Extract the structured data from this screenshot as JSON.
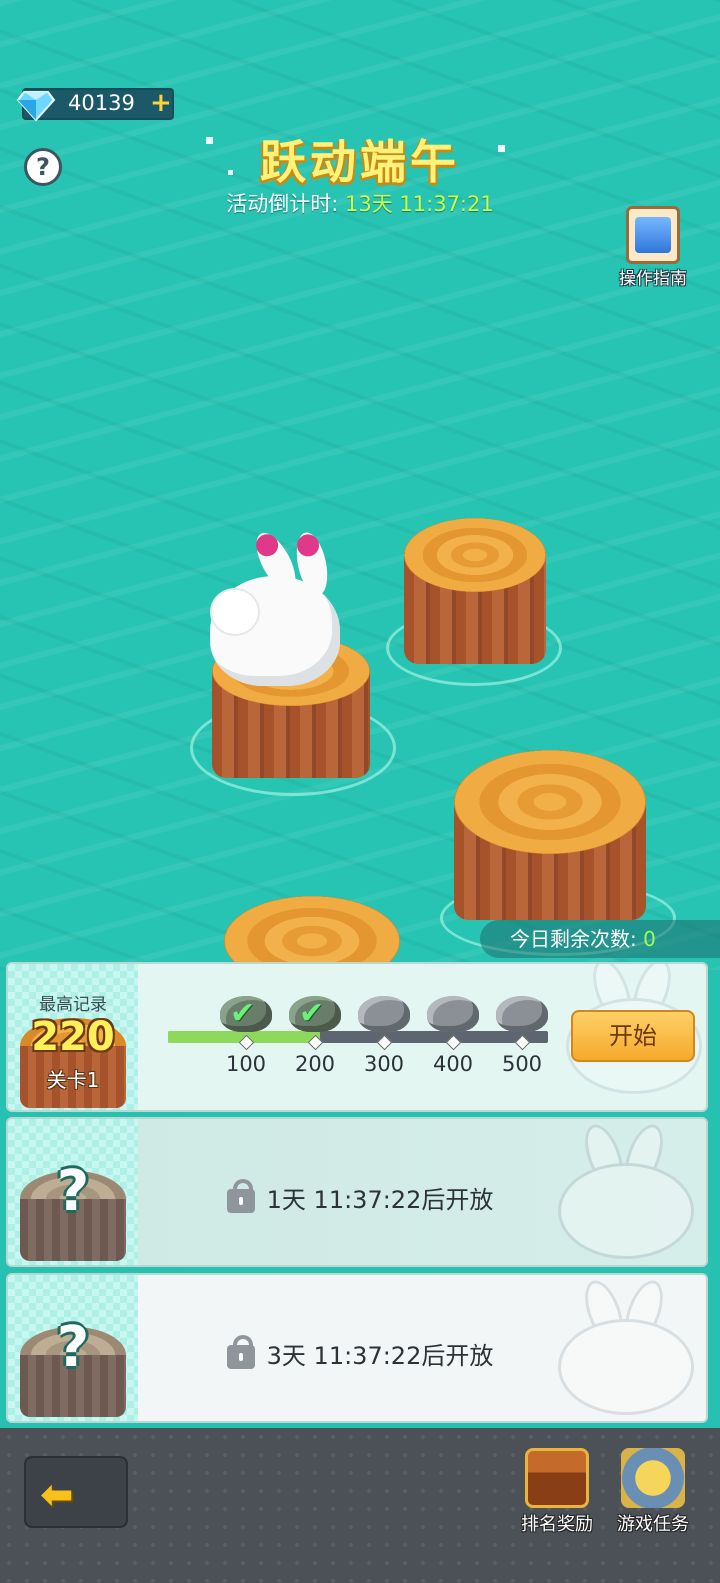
{
  "top": {
    "gems": "40139",
    "plus_icon": "+",
    "help_icon": "?",
    "title": "跃动端午",
    "countdown_label": "活动倒计时:",
    "countdown_value": "13天 11:37:21",
    "guide_label": "操作指南"
  },
  "board": {
    "remaining_label": "今日剩余次数:",
    "remaining_value": "0"
  },
  "levels": [
    {
      "record_label": "最高记录",
      "record_value": "220",
      "stage_label": "关卡1",
      "progress": 0.4,
      "milestones": [
        {
          "label": "100",
          "done": true
        },
        {
          "label": "200",
          "done": true
        },
        {
          "label": "300",
          "done": false
        },
        {
          "label": "400",
          "done": false
        },
        {
          "label": "500",
          "done": false
        }
      ],
      "start_label": "开始"
    },
    {
      "question_mark": "?",
      "locked_text": "1天 11:37:22后开放"
    },
    {
      "question_mark": "?",
      "locked_text": "3天 11:37:22后开放"
    }
  ],
  "bottom": {
    "back_icon": "back-arrow-icon",
    "ranking_label": "排名奖励",
    "tasks_label": "游戏任务"
  }
}
